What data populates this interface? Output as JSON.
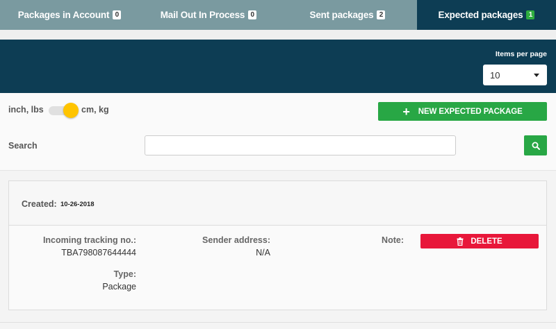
{
  "tabs": [
    {
      "label": "Packages in Account",
      "count": "0"
    },
    {
      "label": "Mail Out In Process",
      "count": "0"
    },
    {
      "label": "Sent packages",
      "count": "2"
    },
    {
      "label": "Expected packages",
      "count": "1",
      "active": true
    }
  ],
  "items_per_page": {
    "label": "Items per page",
    "value": "10"
  },
  "units": {
    "left": "inch, lbs",
    "right": "cm, kg",
    "state": "cm, kg"
  },
  "new_button_label": "NEW EXPECTED PACKAGE",
  "search": {
    "label": "Search",
    "value": "",
    "placeholder": ""
  },
  "package": {
    "created_label": "Created:",
    "created_value": "10-26-2018",
    "tracking_label": "Incoming tracking no.:",
    "tracking_value": "TBA798087644444",
    "sender_label": "Sender address:",
    "sender_value": "N/A",
    "note_label": "Note:",
    "type_label": "Type:",
    "type_value": "Package",
    "delete_label": "DELETE"
  },
  "colors": {
    "tab_bg": "#7a9aa0",
    "active_tab": "#0d3d54",
    "header": "#0d3d54",
    "green": "#28a745",
    "red": "#e8173a",
    "toggle_knob": "#ffc400"
  },
  "icons": [
    "plus-icon",
    "search-icon",
    "trash-icon",
    "caret-down-icon"
  ]
}
